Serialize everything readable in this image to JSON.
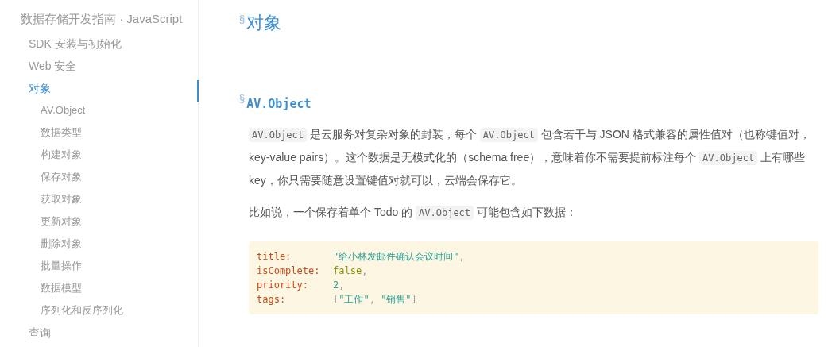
{
  "sidebar": {
    "title": "数据存储开发指南 · JavaScript",
    "items": [
      {
        "label": "SDK 安装与初始化",
        "selected": false
      },
      {
        "label": "Web 安全",
        "selected": false
      },
      {
        "label": "对象",
        "selected": true,
        "children": [
          {
            "label": "AV.Object",
            "selected": false
          },
          {
            "label": "数据类型",
            "selected": false
          },
          {
            "label": "构建对象",
            "selected": false
          },
          {
            "label": "保存对象",
            "selected": false
          },
          {
            "label": "获取对象",
            "selected": false
          },
          {
            "label": "更新对象",
            "selected": false
          },
          {
            "label": "删除对象",
            "selected": false
          },
          {
            "label": "批量操作",
            "selected": false
          },
          {
            "label": "数据模型",
            "selected": false
          },
          {
            "label": "序列化和反序列化",
            "selected": false
          }
        ]
      },
      {
        "label": "查询",
        "selected": false
      }
    ]
  },
  "article": {
    "anchor_mark": "§",
    "title": "对象",
    "section": {
      "anchor_mark": "§",
      "title": "AV.Object",
      "paragraphs": [
        [
          {
            "kind": "code",
            "text": "AV.Object"
          },
          {
            "kind": "text",
            "text": " 是云服务对复杂对象的封装，每个 "
          },
          {
            "kind": "code",
            "text": "AV.Object"
          },
          {
            "kind": "text",
            "text": " 包含若干与 JSON 格式兼容的属性值对（也称键值对，key-value pairs）。这个数据是无模式化的（schema free），意味着你不需要提前标注每个 "
          },
          {
            "kind": "code",
            "text": "AV.Object"
          },
          {
            "kind": "text",
            "text": " 上有哪些 key，你只需要随意设置键值对就可以，云端会保存它。"
          }
        ],
        [
          {
            "kind": "text",
            "text": "比如说，一个保存着单个 Todo 的 "
          },
          {
            "kind": "code",
            "text": "AV.Object"
          },
          {
            "kind": "text",
            "text": " 可能包含如下数据："
          }
        ]
      ],
      "code_block": [
        {
          "key": "title:",
          "tokens": [
            {
              "kind": "string",
              "text": "\"给小林发邮件确认会议时间\""
            },
            {
              "kind": "punct",
              "text": ","
            }
          ]
        },
        {
          "key": "isComplete:",
          "tokens": [
            {
              "kind": "bool",
              "text": "false"
            },
            {
              "kind": "punct",
              "text": ","
            }
          ]
        },
        {
          "key": "priority:",
          "tokens": [
            {
              "kind": "number",
              "text": "2"
            },
            {
              "kind": "punct",
              "text": ","
            }
          ]
        },
        {
          "key": "tags:",
          "tokens": [
            {
              "kind": "punct",
              "text": "["
            },
            {
              "kind": "string",
              "text": "\"工作\""
            },
            {
              "kind": "punct",
              "text": ", "
            },
            {
              "kind": "string",
              "text": "\"销售\""
            },
            {
              "kind": "punct",
              "text": "]"
            }
          ]
        }
      ]
    }
  }
}
